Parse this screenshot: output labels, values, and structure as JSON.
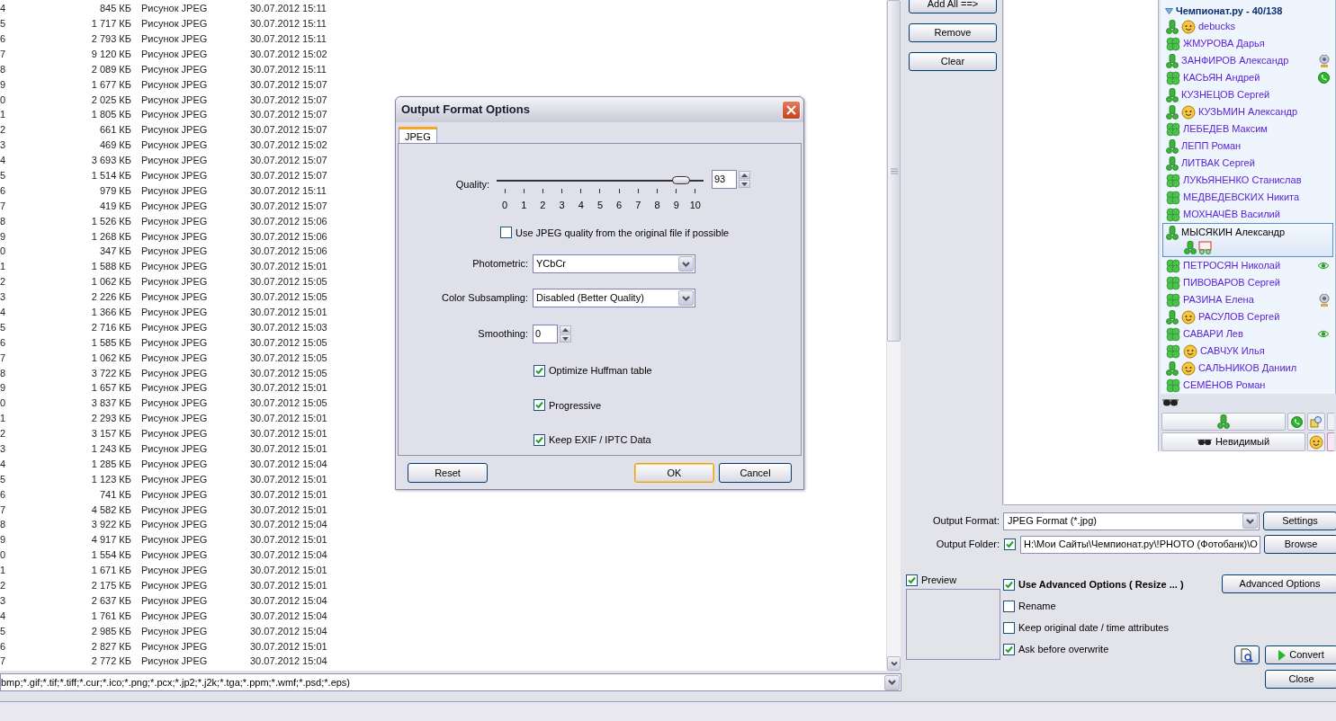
{
  "file_list": {
    "rows": [
      {
        "column_1": "4",
        "size": "845 КБ",
        "type": "Рисунок JPEG",
        "modified": "30.07.2012 15:11"
      },
      {
        "column_1": "5",
        "size": "1 717 КБ",
        "type": "Рисунок JPEG",
        "modified": "30.07.2012 15:11"
      },
      {
        "column_1": "6",
        "size": "2 793 КБ",
        "type": "Рисунок JPEG",
        "modified": "30.07.2012 15:11"
      },
      {
        "column_1": "7",
        "size": "9 120 КБ",
        "type": "Рисунок JPEG",
        "modified": "30.07.2012 15:02"
      },
      {
        "column_1": "8",
        "size": "2 089 КБ",
        "type": "Рисунок JPEG",
        "modified": "30.07.2012 15:11"
      },
      {
        "column_1": "9",
        "size": "1 677 КБ",
        "type": "Рисунок JPEG",
        "modified": "30.07.2012 15:07"
      },
      {
        "column_1": "0",
        "size": "2 025 КБ",
        "type": "Рисунок JPEG",
        "modified": "30.07.2012 15:07"
      },
      {
        "column_1": "1",
        "size": "1 805 КБ",
        "type": "Рисунок JPEG",
        "modified": "30.07.2012 15:07"
      },
      {
        "column_1": "2",
        "size": "661 КБ",
        "type": "Рисунок JPEG",
        "modified": "30.07.2012 15:07"
      },
      {
        "column_1": "3",
        "size": "469 КБ",
        "type": "Рисунок JPEG",
        "modified": "30.07.2012 15:02"
      },
      {
        "column_1": "4",
        "size": "3 693 КБ",
        "type": "Рисунок JPEG",
        "modified": "30.07.2012 15:07"
      },
      {
        "column_1": "5",
        "size": "1 514 КБ",
        "type": "Рисунок JPEG",
        "modified": "30.07.2012 15:07"
      },
      {
        "column_1": "6",
        "size": "979 КБ",
        "type": "Рисунок JPEG",
        "modified": "30.07.2012 15:11"
      },
      {
        "column_1": "7",
        "size": "419 КБ",
        "type": "Рисунок JPEG",
        "modified": "30.07.2012 15:07"
      },
      {
        "column_1": "8",
        "size": "1 526 КБ",
        "type": "Рисунок JPEG",
        "modified": "30.07.2012 15:06"
      },
      {
        "column_1": "9",
        "size": "1 268 КБ",
        "type": "Рисунок JPEG",
        "modified": "30.07.2012 15:06"
      },
      {
        "column_1": "0",
        "size": "347 КБ",
        "type": "Рисунок JPEG",
        "modified": "30.07.2012 15:06"
      },
      {
        "column_1": "1",
        "size": "1 588 КБ",
        "type": "Рисунок JPEG",
        "modified": "30.07.2012 15:01"
      },
      {
        "column_1": "2",
        "size": "1 062 КБ",
        "type": "Рисунок JPEG",
        "modified": "30.07.2012 15:05"
      },
      {
        "column_1": "3",
        "size": "2 226 КБ",
        "type": "Рисунок JPEG",
        "modified": "30.07.2012 15:05"
      },
      {
        "column_1": "4",
        "size": "1 366 КБ",
        "type": "Рисунок JPEG",
        "modified": "30.07.2012 15:01"
      },
      {
        "column_1": "5",
        "size": "2 716 КБ",
        "type": "Рисунок JPEG",
        "modified": "30.07.2012 15:03"
      },
      {
        "column_1": "6",
        "size": "1 585 КБ",
        "type": "Рисунок JPEG",
        "modified": "30.07.2012 15:05"
      },
      {
        "column_1": "7",
        "size": "1 062 КБ",
        "type": "Рисунок JPEG",
        "modified": "30.07.2012 15:05"
      },
      {
        "column_1": "8",
        "size": "3 722 КБ",
        "type": "Рисунок JPEG",
        "modified": "30.07.2012 15:05"
      },
      {
        "column_1": "9",
        "size": "1 657 КБ",
        "type": "Рисунок JPEG",
        "modified": "30.07.2012 15:01"
      },
      {
        "column_1": "0",
        "size": "3 837 КБ",
        "type": "Рисунок JPEG",
        "modified": "30.07.2012 15:05"
      },
      {
        "column_1": "1",
        "size": "2 293 КБ",
        "type": "Рисунок JPEG",
        "modified": "30.07.2012 15:01"
      },
      {
        "column_1": "2",
        "size": "3 157 КБ",
        "type": "Рисунок JPEG",
        "modified": "30.07.2012 15:01"
      },
      {
        "column_1": "3",
        "size": "1 243 КБ",
        "type": "Рисунок JPEG",
        "modified": "30.07.2012 15:01"
      },
      {
        "column_1": "4",
        "size": "1 285 КБ",
        "type": "Рисунок JPEG",
        "modified": "30.07.2012 15:04"
      },
      {
        "column_1": "5",
        "size": "1 123 КБ",
        "type": "Рисунок JPEG",
        "modified": "30.07.2012 15:01"
      },
      {
        "column_1": "6",
        "size": "741 КБ",
        "type": "Рисунок JPEG",
        "modified": "30.07.2012 15:01"
      },
      {
        "column_1": "7",
        "size": "4 582 КБ",
        "type": "Рисунок JPEG",
        "modified": "30.07.2012 15:01"
      },
      {
        "column_1": "8",
        "size": "3 922 КБ",
        "type": "Рисунок JPEG",
        "modified": "30.07.2012 15:04"
      },
      {
        "column_1": "9",
        "size": "4 917 КБ",
        "type": "Рисунок JPEG",
        "modified": "30.07.2012 15:01"
      },
      {
        "column_1": "0",
        "size": "1 554 КБ",
        "type": "Рисунок JPEG",
        "modified": "30.07.2012 15:04"
      },
      {
        "column_1": "1",
        "size": "1 671 КБ",
        "type": "Рисунок JPEG",
        "modified": "30.07.2012 15:01"
      },
      {
        "column_1": "2",
        "size": "2 175 КБ",
        "type": "Рисунок JPEG",
        "modified": "30.07.2012 15:01"
      },
      {
        "column_1": "3",
        "size": "2 637 КБ",
        "type": "Рисунок JPEG",
        "modified": "30.07.2012 15:04"
      },
      {
        "column_1": "4",
        "size": "1 761 КБ",
        "type": "Рисунок JPEG",
        "modified": "30.07.2012 15:04"
      },
      {
        "column_1": "5",
        "size": "2 985 КБ",
        "type": "Рисунок JPEG",
        "modified": "30.07.2012 15:04"
      },
      {
        "column_1": "6",
        "size": "2 827 КБ",
        "type": "Рисунок JPEG",
        "modified": "30.07.2012 15:01"
      },
      {
        "column_1": "7",
        "size": "2 772 КБ",
        "type": "Рисунок JPEG",
        "modified": "30.07.2012 15:04"
      }
    ]
  },
  "file_filter": {
    "value": "bmp;*.gif;*.tif;*.tiff;*.cur;*.ico;*.png;*.pcx;*.jp2;*.j2k;*.tga;*.ppm;*.wmf;*.psd;*.eps)"
  },
  "list_buttons": [
    "Add All ==>",
    "Remove",
    "Clear"
  ],
  "output": {
    "format_label": "Output Format:",
    "format_value": "JPEG Format (*.jpg)",
    "settings_button": "Settings",
    "folder_label": "Output Folder:",
    "folder_enabled": true,
    "folder_value": "H:\\Мои Сайты\\Чемпионат.ру\\!PHOTO (Фотобанк)\\O",
    "browse_button": "Browse"
  },
  "preview": {
    "label": "Preview",
    "checked": true
  },
  "options": [
    {
      "label": "Use Advanced Options ( Resize ... )",
      "checked": true,
      "bold": true
    },
    {
      "label": "Rename",
      "checked": false,
      "bold": false
    },
    {
      "label": "Keep original date / time attributes",
      "checked": false,
      "bold": false
    },
    {
      "label": "Ask before overwrite",
      "checked": true,
      "bold": false
    }
  ],
  "advanced_button": "Advanced Options",
  "convert_button": "Convert",
  "close_button": "Close",
  "dialog": {
    "title": "Output Format Options",
    "tabs": [
      {
        "label": "JPEG",
        "selected": true
      }
    ],
    "quality": {
      "label": "Quality:",
      "level": 0.93,
      "value": "93",
      "ticks": [
        "0",
        "1",
        "2",
        "3",
        "4",
        "5",
        "6",
        "7",
        "8",
        "9",
        "10"
      ]
    },
    "use_original_quality": {
      "label": "Use JPEG quality from the original file if possible",
      "checked": false
    },
    "photometric": {
      "label": "Photometric:",
      "value": "YCbCr"
    },
    "color_subsampling": {
      "label": "Color Subsampling:",
      "value": "Disabled (Better Quality)"
    },
    "smoothing": {
      "label": "Smoothing:",
      "value": "0"
    },
    "checkboxes": [
      {
        "label": "Optimize Huffman table",
        "checked": true
      },
      {
        "label": "Progressive",
        "checked": true
      },
      {
        "label": "Keep EXIF / IPTC Data",
        "checked": true
      }
    ],
    "buttons": [
      {
        "label": "Reset",
        "default": false
      },
      {
        "label": "OK",
        "default": true
      },
      {
        "label": "Cancel",
        "default": false
      }
    ]
  },
  "contact_window": {
    "group": {
      "label": "Чемпионат.ру - 40/138",
      "expanded": true
    },
    "contacts": [
      {
        "name": "debucks",
        "kind": "qip",
        "avatar": true,
        "selected": false
      },
      {
        "name": "ЖМУРОВА Дарья",
        "kind": "clover",
        "avatar": false,
        "selected": false
      },
      {
        "name": "ЗАНФИРОВ Александр",
        "kind": "qip",
        "avatar": false,
        "status": {
          "kind": "webcam"
        },
        "selected": false
      },
      {
        "name": "КАСЬЯН Андрей",
        "kind": "clover",
        "avatar": false,
        "status": {
          "kind": "phone"
        },
        "selected": false
      },
      {
        "name": "КУЗНЕЦОВ Сергей",
        "kind": "qip",
        "avatar": false,
        "selected": false
      },
      {
        "name": "КУЗЬМИН Александр",
        "kind": "qip",
        "avatar": true,
        "selected": false
      },
      {
        "name": "ЛЕБЕДЕВ Максим",
        "kind": "clover",
        "avatar": false,
        "selected": false
      },
      {
        "name": "ЛЕПП Роман",
        "kind": "qip",
        "avatar": false,
        "selected": false
      },
      {
        "name": "ЛИТВАК Сергей",
        "kind": "qip",
        "avatar": false,
        "selected": false
      },
      {
        "name": "ЛУКЬЯНЕНКО Станислав",
        "kind": "clover",
        "avatar": false,
        "selected": false
      },
      {
        "name": "МЕДВЕДЕВСКИХ Никита",
        "kind": "clover",
        "avatar": false,
        "selected": false
      },
      {
        "name": "МОХНАЧЁВ Василий",
        "kind": "clover",
        "avatar": false,
        "selected": false
      },
      {
        "name": "МЫСЯКИН Александр",
        "kind": "qip",
        "avatar": false,
        "selected": true
      },
      {
        "name": "ПЕТРОСЯН Николай",
        "kind": "clover",
        "avatar": false,
        "status": {
          "kind": "eye"
        },
        "selected": false
      },
      {
        "name": "ПИВОВАРОВ Сергей",
        "kind": "clover",
        "avatar": false,
        "selected": false
      },
      {
        "name": "РАЗИНА Елена",
        "kind": "clover",
        "avatar": false,
        "status": {
          "kind": "webcam"
        },
        "selected": false
      },
      {
        "name": "РАСУЛОВ Сергей",
        "kind": "qip",
        "avatar": true,
        "selected": false
      },
      {
        "name": "САВАРИ Лев",
        "kind": "clover",
        "avatar": false,
        "status": {
          "kind": "eye"
        },
        "selected": false
      },
      {
        "name": "САВЧУК Илья",
        "kind": "clover",
        "avatar": true,
        "selected": false
      },
      {
        "name": "САЛЬНИКОВ Даниил",
        "kind": "qip",
        "avatar": true,
        "selected": false
      },
      {
        "name": "СЕМЁНОВ Роман",
        "kind": "clover",
        "avatar": false,
        "selected": false
      }
    ],
    "status_button": "Невидимый"
  }
}
